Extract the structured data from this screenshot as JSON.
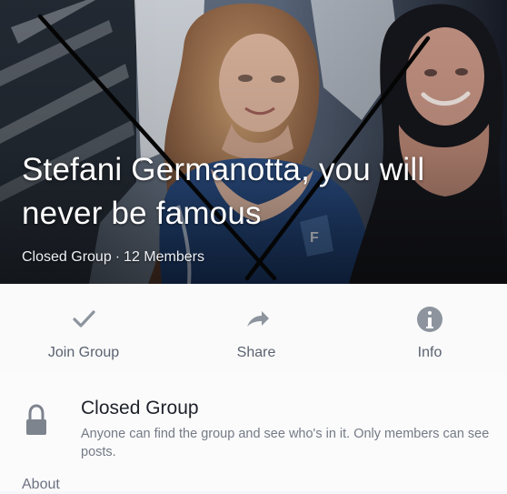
{
  "group": {
    "title": "Stefani Germanotta, you will never be famous",
    "privacy": "Closed Group",
    "separator": "·",
    "members": "12 Members"
  },
  "actions": {
    "join": {
      "label": "Join Group",
      "icon": "check-icon"
    },
    "share": {
      "label": "Share",
      "icon": "share-arrow-icon"
    },
    "info": {
      "label": "Info",
      "icon": "info-icon"
    }
  },
  "privacy_section": {
    "icon": "lock-icon",
    "title": "Closed Group",
    "description": "Anyone can find the group and see who's in it. Only members can see posts."
  },
  "about": {
    "label": "About"
  },
  "colors": {
    "icon_gray": "#8d949e",
    "label_gray": "#5a6270",
    "title_white": "#ffffff",
    "panel_bg": "#fafafa"
  }
}
